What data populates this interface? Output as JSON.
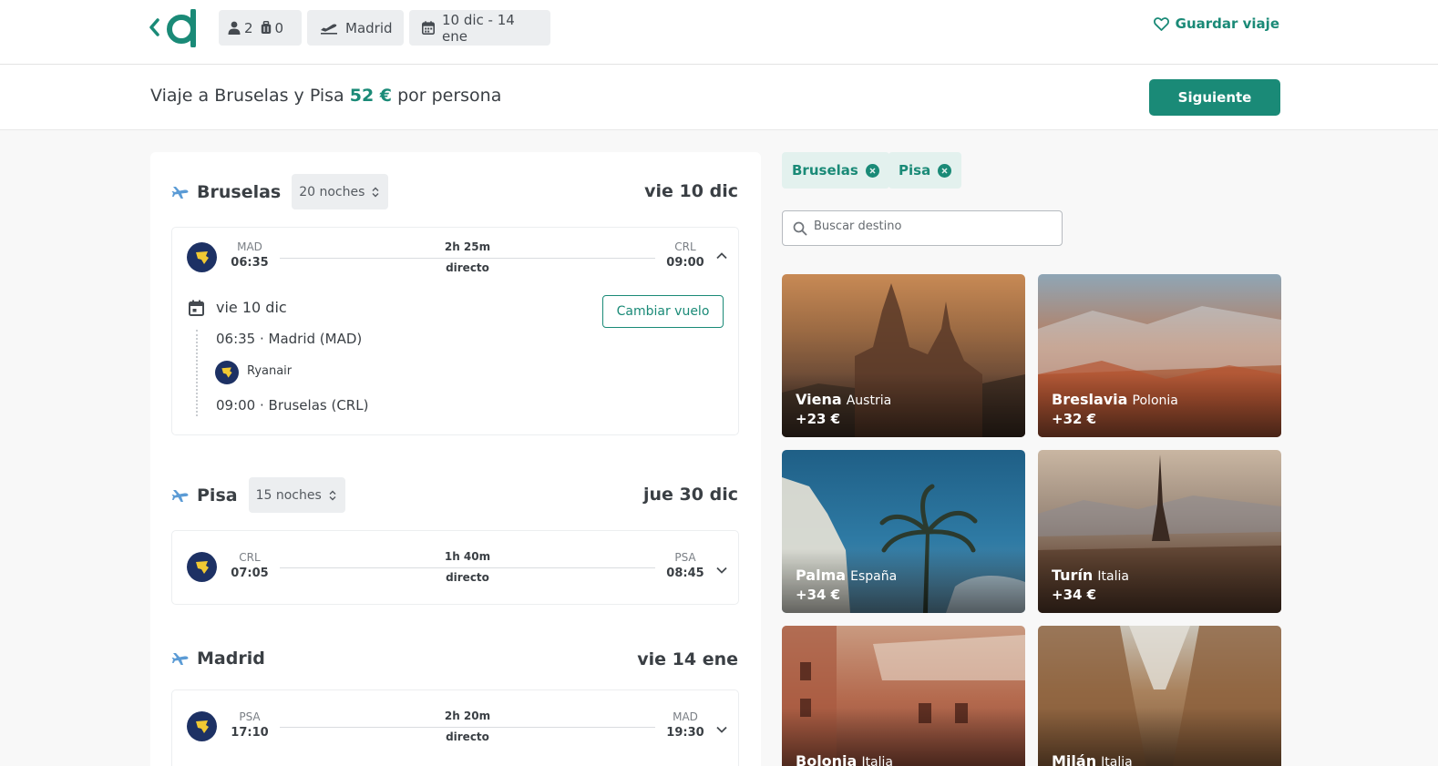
{
  "header": {
    "passengers": "2",
    "bags": "0",
    "origin": "Madrid",
    "dates": "10 dic - 14 ene",
    "save_label": "Guardar viaje"
  },
  "summary": {
    "title_prefix": "Viaje a Bruselas y Pisa",
    "price": "52 €",
    "title_suffix": "por persona",
    "next_label": "Siguiente"
  },
  "segments": [
    {
      "city": "Bruselas",
      "nights": "20 noches",
      "date": "vie 10 dic",
      "flight": {
        "from_code": "MAD",
        "from_time": "06:35",
        "duration": "2h 25m",
        "stops": "directo",
        "to_code": "CRL",
        "to_time": "09:00"
      },
      "details": {
        "date": "vie 10 dic",
        "change_label": "Cambiar vuelo",
        "departure": "06:35 · Madrid (MAD)",
        "airline": "Ryanair",
        "arrival": "09:00 · Bruselas (CRL)"
      }
    },
    {
      "city": "Pisa",
      "nights": "15 noches",
      "date": "jue 30 dic",
      "flight": {
        "from_code": "CRL",
        "from_time": "07:05",
        "duration": "1h 40m",
        "stops": "directo",
        "to_code": "PSA",
        "to_time": "08:45"
      }
    },
    {
      "city": "Madrid",
      "date": "vie 14 ene",
      "flight": {
        "from_code": "PSA",
        "from_time": "17:10",
        "duration": "2h 20m",
        "stops": "directo",
        "to_code": "MAD",
        "to_time": "19:30"
      }
    }
  ],
  "chips": [
    "Bruselas",
    "Pisa"
  ],
  "search": {
    "placeholder": "Buscar destino"
  },
  "destinations": [
    {
      "city": "Viena",
      "country": "Austria",
      "extra": "+23 €"
    },
    {
      "city": "Breslavia",
      "country": "Polonia",
      "extra": "+32 €"
    },
    {
      "city": "Palma",
      "country": "España",
      "extra": "+34 €"
    },
    {
      "city": "Turín",
      "country": "Italia",
      "extra": "+34 €"
    },
    {
      "city": "Bolonia",
      "country": "Italia"
    },
    {
      "city": "Milán",
      "country": "Italia"
    }
  ],
  "colors": {
    "accent": "#1a8a77",
    "airline_logo": "#1d3164"
  }
}
